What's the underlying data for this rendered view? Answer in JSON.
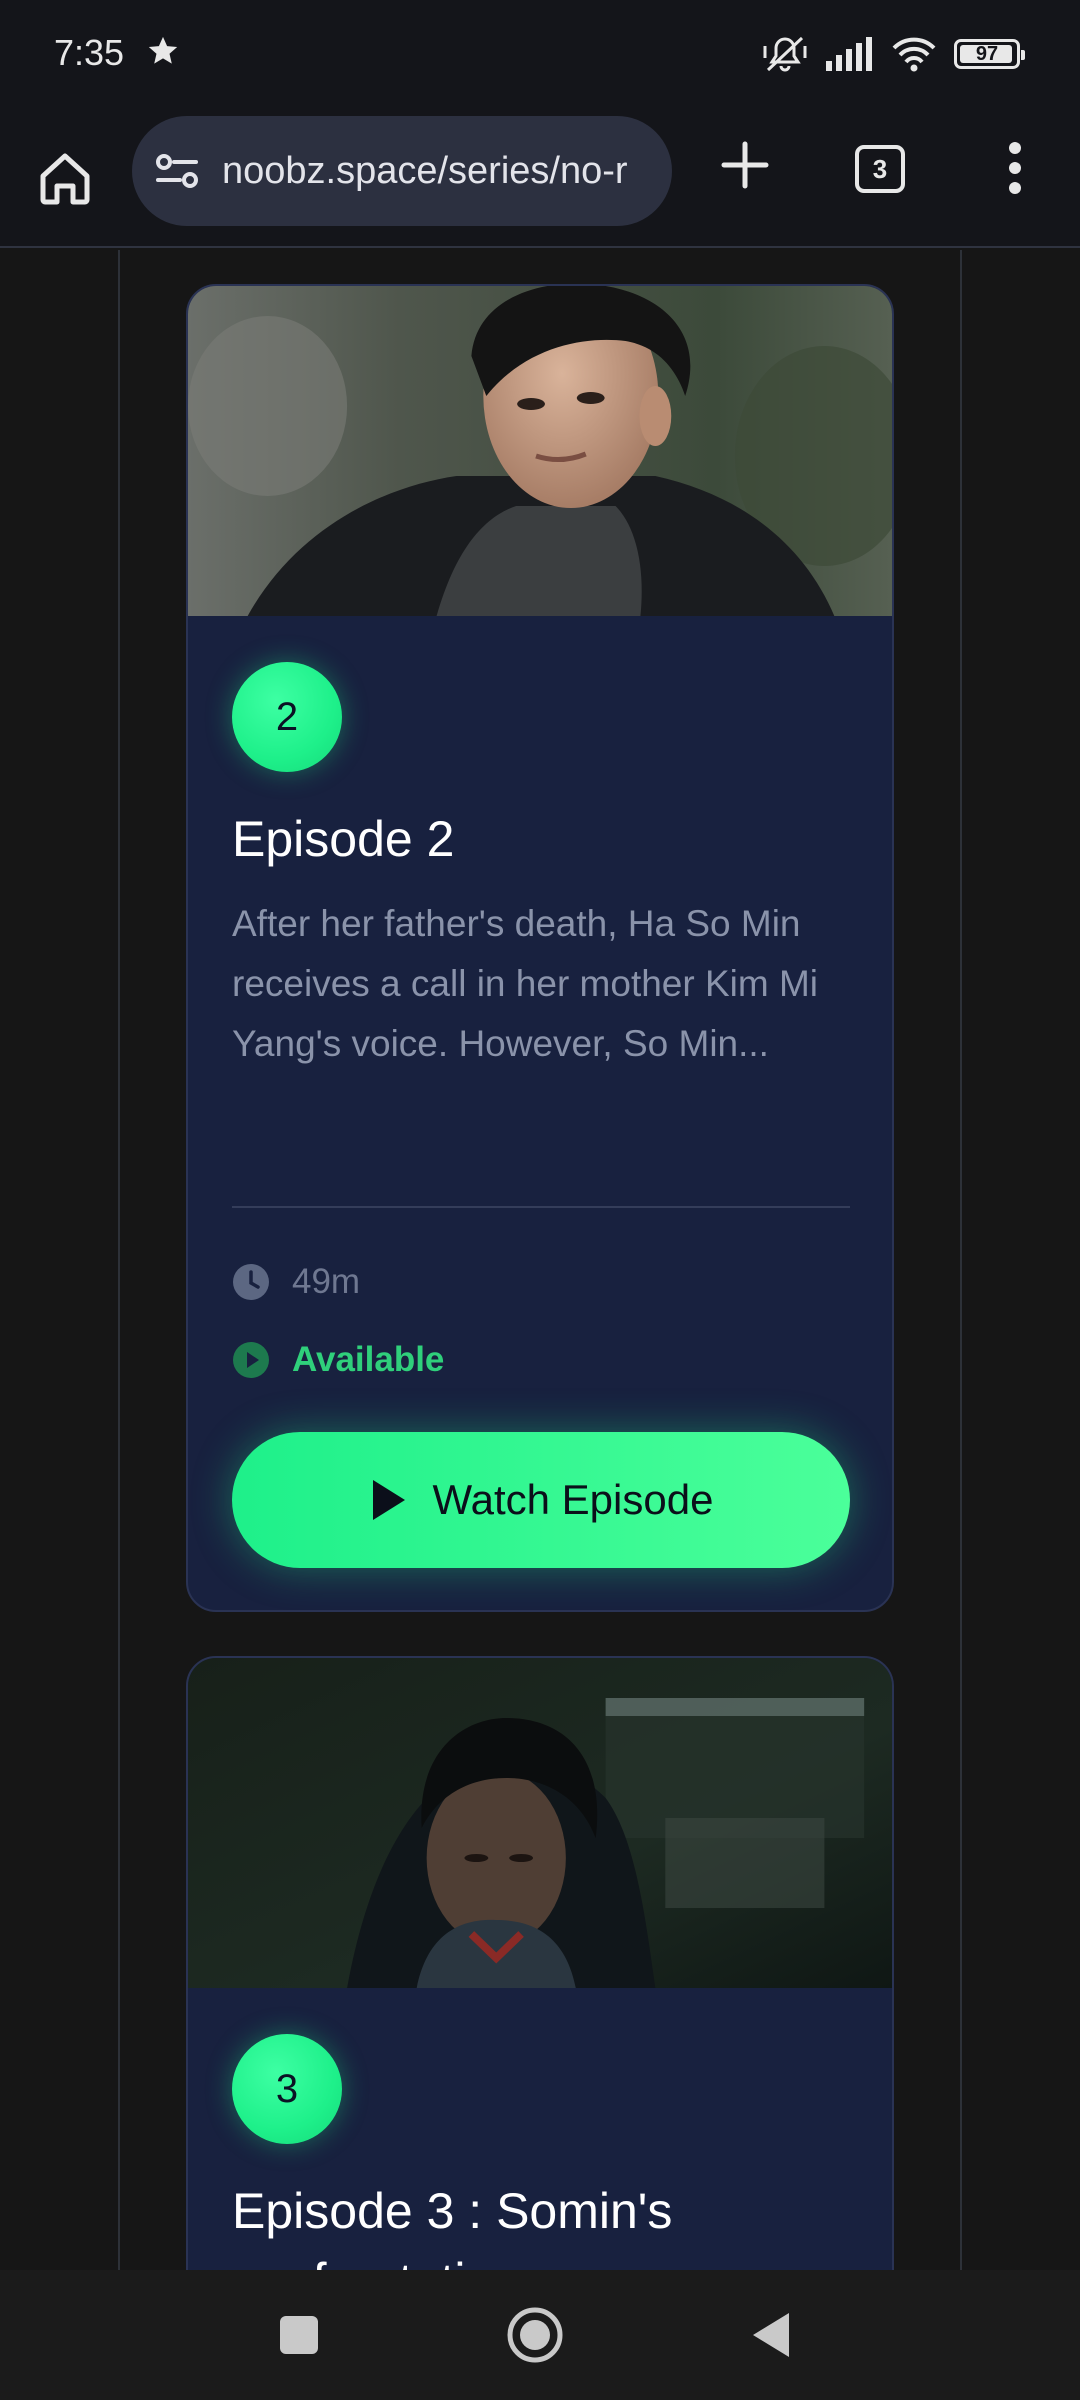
{
  "status_bar": {
    "time": "7:35",
    "battery_level": "97",
    "icons": [
      "star-icon",
      "mute-vibrate-icon",
      "signal-icon",
      "wifi-icon",
      "battery-icon"
    ]
  },
  "browser": {
    "url": "noobz.space/series/no-r",
    "tab_count": "3",
    "icons": [
      "home-icon",
      "site-settings-icon",
      "plus-icon",
      "tab-switcher-icon",
      "more-vert-icon"
    ]
  },
  "episodes": [
    {
      "number": "2",
      "title": "Episode 2",
      "description": "After her father's death, Ha So Min receives a call in her mother Kim Mi Yang's voice. However, So Min...",
      "duration": "49m",
      "status": "Available",
      "button_label": "Watch Episode"
    },
    {
      "number": "3",
      "title": "Episode 3 : Somin's",
      "title_cut": "confrontation"
    }
  ],
  "colors": {
    "accent": "#1ef08a",
    "card_bg": "#18213f",
    "page_bg": "#161616",
    "available": "#2fd07b"
  },
  "nav_bar": {
    "icons": [
      "recents-square-icon",
      "home-circle-icon",
      "back-triangle-icon"
    ]
  }
}
